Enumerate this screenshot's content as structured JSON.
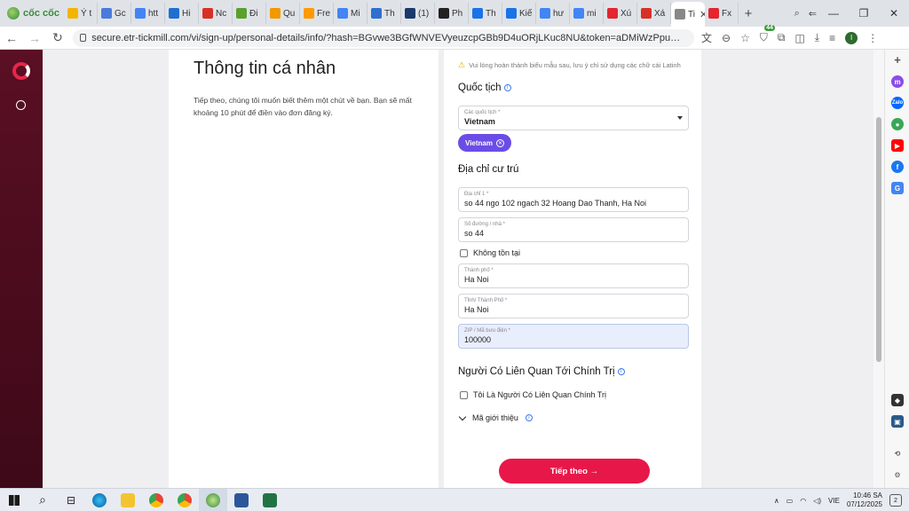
{
  "browser": {
    "brand": "cốc cốc",
    "tabs": [
      {
        "label": "Ý t",
        "icon": "google-ads-icon",
        "color": "#f4b400"
      },
      {
        "label": "Gc",
        "icon": "gemini-icon",
        "color": "#4a7bdc"
      },
      {
        "label": "htt",
        "icon": "google-icon",
        "color": "#4285f4"
      },
      {
        "label": "Hi",
        "icon": "bing-icon",
        "color": "#1f6fd1"
      },
      {
        "label": "Nc",
        "icon": "news-icon",
        "color": "#d93025"
      },
      {
        "label": "Đi",
        "icon": "leaf-icon",
        "color": "#5aa02c"
      },
      {
        "label": "Qu",
        "icon": "orange-app-icon",
        "color": "#f29900"
      },
      {
        "label": "Fre",
        "icon": "amazon-icon",
        "color": "#ff9900"
      },
      {
        "label": "Mi",
        "icon": "google-icon",
        "color": "#4285f4"
      },
      {
        "label": "Th",
        "icon": "chart-icon",
        "color": "#2f6fcf"
      },
      {
        "label": "(1)",
        "icon": "check-logo-icon",
        "color": "#1b3a6b"
      },
      {
        "label": "Ph",
        "icon": "threads-icon",
        "color": "#222222"
      },
      {
        "label": "Th",
        "icon": "blue-app-icon",
        "color": "#1a73e8"
      },
      {
        "label": "Kiế",
        "icon": "globe-icon",
        "color": "#1a73e8"
      },
      {
        "label": "hư",
        "icon": "google-icon",
        "color": "#4285f4"
      },
      {
        "label": "mi",
        "icon": "google-icon",
        "color": "#4285f4"
      },
      {
        "label": "Xú",
        "icon": "opera-icon",
        "color": "#e3262f"
      },
      {
        "label": "Xá",
        "icon": "gmail-icon",
        "color": "#d93025"
      },
      {
        "label": "Ti",
        "icon": "page-icon",
        "color": "#888888",
        "active": true
      },
      {
        "label": "Fx",
        "icon": "f-logo-icon",
        "color": "#e3262f"
      }
    ],
    "new_tab": "+",
    "window": {
      "minimize": "—",
      "maximize": "❐",
      "close": "✕"
    },
    "url": "secure.etr-tickmill.com/vi/sign-up/personal-details/info/?hash=BGvwe3BGfWNVEVyeuzcpGBb9D4uORjLKuc8NU&token=aDMiWzPpuU0MGlGsWiMbHA4LaY...",
    "extension_badge": "44",
    "profile_initial": "I"
  },
  "page": {
    "title": "Thông tin cá nhân",
    "subtitle": "Tiếp theo, chúng tôi muốn biết thêm một chút về bạn. Bạn sẽ mất khoảng 10 phút để điền vào đơn đăng ký.",
    "warning": "Vui lòng hoàn thành biểu mẫu sau, lưu ý chỉ sử dụng các chữ cái Latinh",
    "nationality": {
      "title": "Quốc tịch",
      "select_label": "Các quốc tịch *",
      "select_value": "Vietnam",
      "chip": "Vietnam"
    },
    "address": {
      "title": "Địa chỉ cư trú",
      "fields": [
        {
          "label": "Địa chỉ 1 *",
          "value": "so 44 ngo 102 ngach 32 Hoang Dao Thanh, Ha Noi"
        },
        {
          "label": "Số đường / nhà *",
          "value": "so 44"
        },
        {
          "label": "Thành phố *",
          "value": "Ha Noi"
        },
        {
          "label": "Tỉnh/ Thành Phố *",
          "value": "Ha Noi"
        },
        {
          "label": "ZIP / Mã bưu điện *",
          "value": "100000"
        }
      ],
      "not_exist_checkbox": "Không tồn tại"
    },
    "pep": {
      "title": "Người Có Liên Quan Tới Chính Trị",
      "checkbox": "Tôi Là Người Có Liên Quan Chính Trị"
    },
    "referral_label": "Mã giới thiệu",
    "next_button": "Tiếp theo →"
  },
  "taskbar": {
    "language": "VIE",
    "time": "10:46 SA",
    "date": "07/12/2025",
    "notifications": "2"
  },
  "colors": {
    "primary_button": "#e8174a",
    "chip": "#6b4de6",
    "rail": "#5a0f24"
  }
}
